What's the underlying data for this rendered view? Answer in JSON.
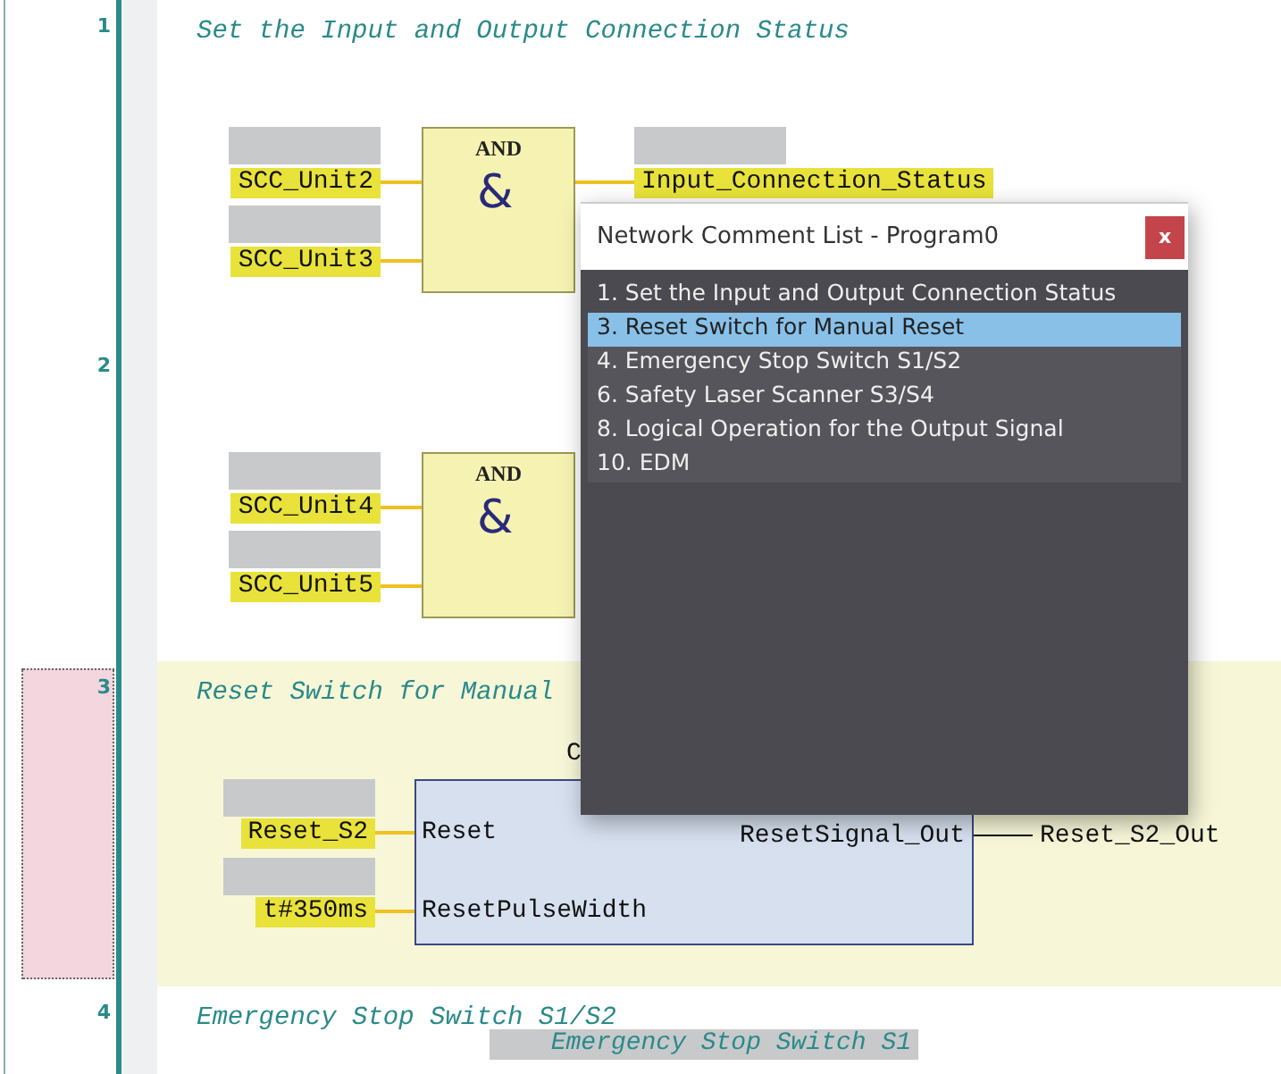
{
  "networks": [
    {
      "number": "1",
      "selected": false,
      "comment": "Set the Input and Output Connection Status"
    },
    {
      "number": "2",
      "selected": false
    },
    {
      "number": "3",
      "selected": true,
      "comment": "Reset Switch for Manual"
    },
    {
      "number": "4",
      "selected": false,
      "comment": "Emergency Stop Switch S1/S2"
    }
  ],
  "blocks": [
    {
      "kind": "and",
      "title": "AND",
      "symbol": "&",
      "inputs": [
        {
          "variable": "SCC_Unit2"
        },
        {
          "variable": "SCC_Unit3"
        }
      ],
      "outputs": [
        {
          "variable": "Input_Connection_Status"
        }
      ]
    },
    {
      "kind": "and",
      "title": "AND",
      "symbol": "&",
      "inputs": [
        {
          "variable": "SCC_Unit4"
        },
        {
          "variable": "SCC_Unit5"
        }
      ]
    },
    {
      "kind": "fb",
      "title": "C",
      "inputs": [
        {
          "variable": "Reset_S2",
          "port": "Reset"
        },
        {
          "variable": "t#350ms",
          "port": "ResetPulseWidth"
        }
      ],
      "outputs": [
        {
          "port": "ResetSignal_Out",
          "variable": "Reset_S2_Out"
        }
      ]
    }
  ],
  "emergency_label": "Emergency Stop Switch S1",
  "dialog": {
    "title": "Network Comment List - Program0",
    "close": "x",
    "items": [
      {
        "label": "1. Set the Input and Output Connection Status",
        "selected": false
      },
      {
        "label": "3. Reset Switch for Manual Reset",
        "selected": true
      },
      {
        "label": "4. Emergency Stop Switch S1/S2",
        "selected": false
      },
      {
        "label": "6. Safety Laser Scanner S3/S4",
        "selected": false
      },
      {
        "label": "8. Logical Operation for the Output Signal",
        "selected": false
      },
      {
        "label": "10. EDM",
        "selected": false
      }
    ]
  }
}
